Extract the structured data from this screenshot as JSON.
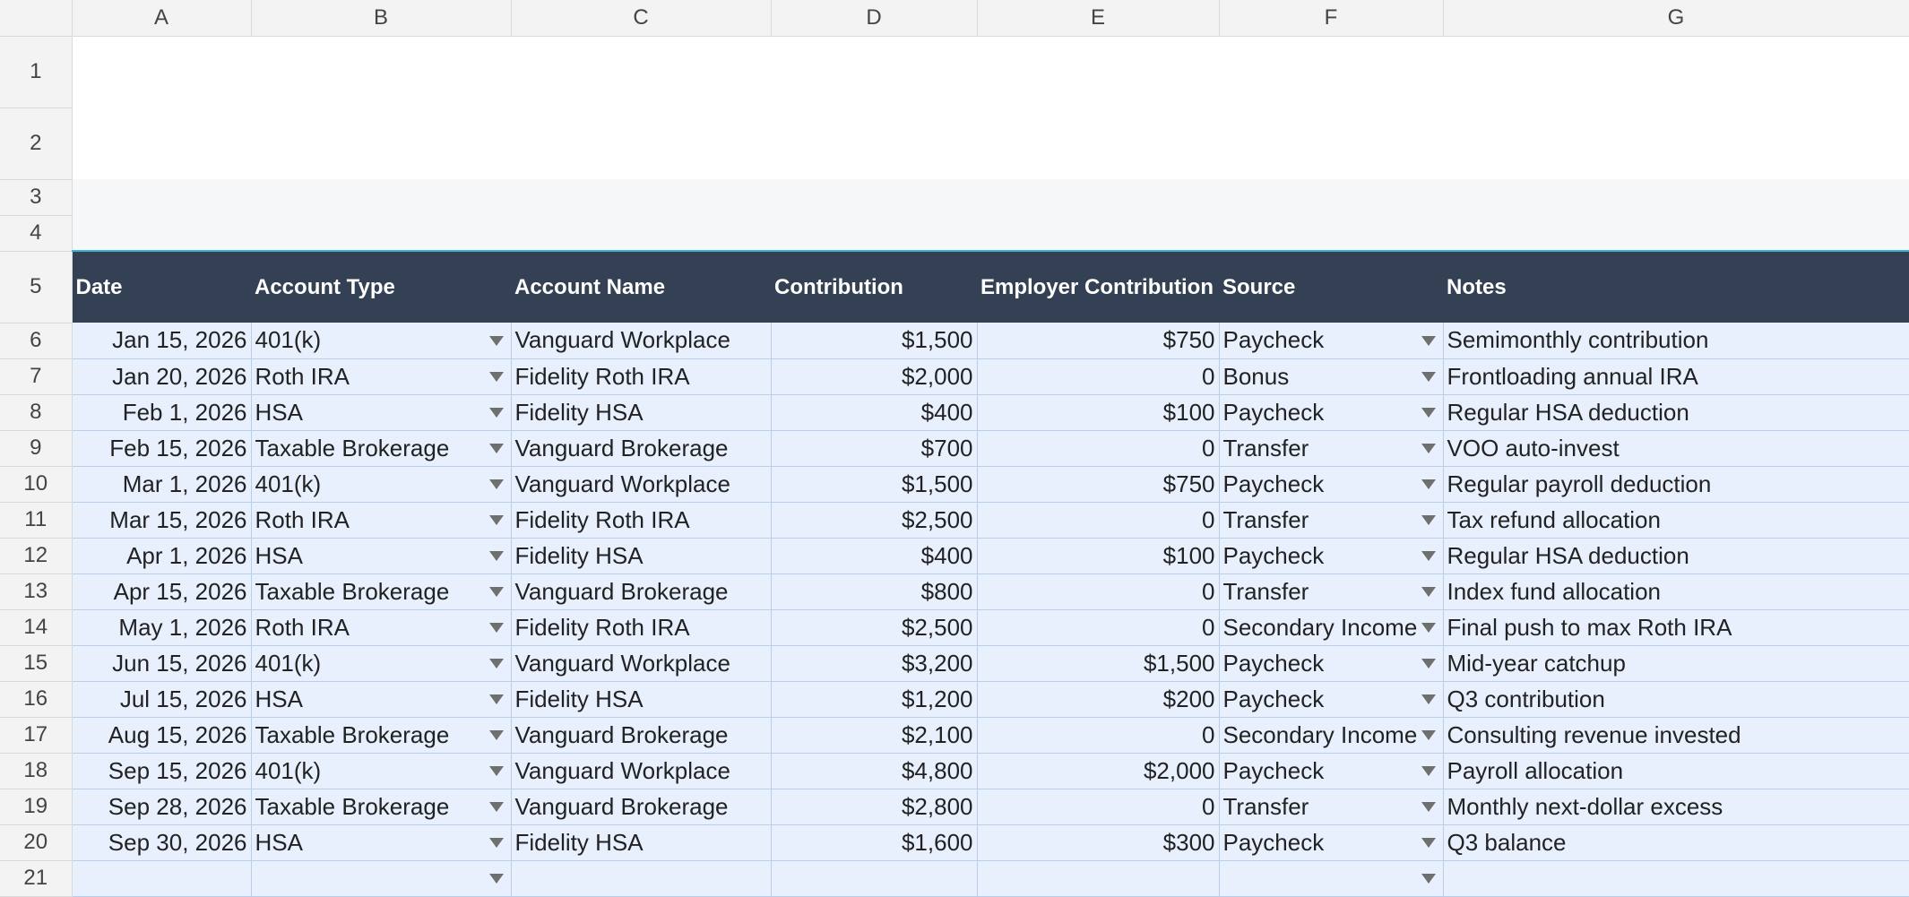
{
  "columns": [
    "A",
    "B",
    "C",
    "D",
    "E",
    "F",
    "G"
  ],
  "header_row": {
    "date": "Date",
    "account_type": "Account Type",
    "account_name": "Account Name",
    "contribution": "Contribution",
    "employer_contribution": "Employer Contribution",
    "source": "Source",
    "notes": "Notes"
  },
  "rows": [
    {
      "num": "6",
      "date": "Jan 15, 2026",
      "type": "401(k)",
      "name": "Vanguard Workplace",
      "contribution": "$1,500",
      "employer": "$750",
      "source": "Paycheck",
      "notes": "Semimonthly contribution"
    },
    {
      "num": "7",
      "date": "Jan 20, 2026",
      "type": "Roth IRA",
      "name": "Fidelity Roth IRA",
      "contribution": "$2,000",
      "employer": "0",
      "source": "Bonus",
      "notes": "Frontloading annual IRA"
    },
    {
      "num": "8",
      "date": "Feb 1, 2026",
      "type": "HSA",
      "name": "Fidelity HSA",
      "contribution": "$400",
      "employer": "$100",
      "source": "Paycheck",
      "notes": "Regular HSA deduction"
    },
    {
      "num": "9",
      "date": "Feb 15, 2026",
      "type": "Taxable Brokerage",
      "name": "Vanguard Brokerage",
      "contribution": "$700",
      "employer": "0",
      "source": "Transfer",
      "notes": "VOO auto-invest"
    },
    {
      "num": "10",
      "date": "Mar 1, 2026",
      "type": "401(k)",
      "name": "Vanguard Workplace",
      "contribution": "$1,500",
      "employer": "$750",
      "source": "Paycheck",
      "notes": "Regular payroll deduction"
    },
    {
      "num": "11",
      "date": "Mar 15, 2026",
      "type": "Roth IRA",
      "name": "Fidelity Roth IRA",
      "contribution": "$2,500",
      "employer": "0",
      "source": "Transfer",
      "notes": "Tax refund allocation"
    },
    {
      "num": "12",
      "date": "Apr 1, 2026",
      "type": "HSA",
      "name": "Fidelity HSA",
      "contribution": "$400",
      "employer": "$100",
      "source": "Paycheck",
      "notes": "Regular HSA deduction"
    },
    {
      "num": "13",
      "date": "Apr 15, 2026",
      "type": "Taxable Brokerage",
      "name": "Vanguard Brokerage",
      "contribution": "$800",
      "employer": "0",
      "source": "Transfer",
      "notes": "Index fund allocation"
    },
    {
      "num": "14",
      "date": "May 1, 2026",
      "type": "Roth IRA",
      "name": "Fidelity Roth IRA",
      "contribution": "$2,500",
      "employer": "0",
      "source": "Secondary Income",
      "notes": "Final push to max Roth IRA"
    },
    {
      "num": "15",
      "date": "Jun 15, 2026",
      "type": "401(k)",
      "name": "Vanguard Workplace",
      "contribution": "$3,200",
      "employer": "$1,500",
      "source": "Paycheck",
      "notes": "Mid-year catchup"
    },
    {
      "num": "16",
      "date": "Jul 15, 2026",
      "type": "HSA",
      "name": "Fidelity HSA",
      "contribution": "$1,200",
      "employer": "$200",
      "source": "Paycheck",
      "notes": "Q3 contribution"
    },
    {
      "num": "17",
      "date": "Aug 15, 2026",
      "type": "Taxable Brokerage",
      "name": "Vanguard Brokerage",
      "contribution": "$2,100",
      "employer": "0",
      "source": "Secondary Income",
      "notes": "Consulting revenue invested"
    },
    {
      "num": "18",
      "date": "Sep 15, 2026",
      "type": "401(k)",
      "name": "Vanguard Workplace",
      "contribution": "$4,800",
      "employer": "$2,000",
      "source": "Paycheck",
      "notes": "Payroll allocation"
    },
    {
      "num": "19",
      "date": "Sep 28, 2026",
      "type": "Taxable Brokerage",
      "name": "Vanguard Brokerage",
      "contribution": "$2,800",
      "employer": "0",
      "source": "Transfer",
      "notes": "Monthly next-dollar excess"
    },
    {
      "num": "20",
      "date": "Sep 30, 2026",
      "type": "HSA",
      "name": "Fidelity HSA",
      "contribution": "$1,600",
      "employer": "$300",
      "source": "Paycheck",
      "notes": "Q3 balance"
    },
    {
      "num": "21",
      "date": "",
      "type": "",
      "name": "",
      "contribution": "",
      "employer": "",
      "source": "",
      "notes": ""
    }
  ],
  "row_labels_top": [
    "1",
    "2",
    "3",
    "4",
    "5"
  ],
  "colors": {
    "header_fill": "#344154",
    "data_fill": "#e8f0fe",
    "band_fill": "#f6f7f9",
    "accent_border": "#3fb1d0"
  },
  "icons": {
    "dropdown": "triangle-down"
  }
}
